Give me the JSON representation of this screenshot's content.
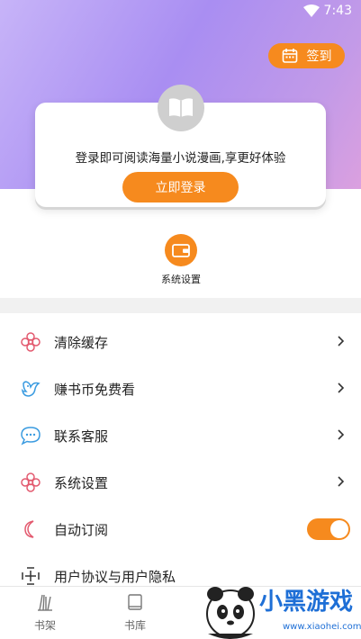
{
  "status_bar": {
    "time": "7:43",
    "wifi_icon": "wifi-icon"
  },
  "header": {
    "signin_label": "签到",
    "signin_icon": "calendar-icon"
  },
  "login_card": {
    "book_icon": "book-icon",
    "prompt": "登录即可阅读海量小说漫画,享更好体验",
    "login_label": "立即登录"
  },
  "quick_actions": [
    {
      "label": "系统设置",
      "icon": "wallet-icon"
    }
  ],
  "menu": {
    "items": [
      {
        "label": "清除缓存",
        "icon": "flower-icon"
      },
      {
        "label": "赚书币免费看",
        "icon": "bird-icon"
      },
      {
        "label": "联系客服",
        "icon": "chat-icon"
      },
      {
        "label": "系统设置",
        "icon": "flower-icon"
      },
      {
        "label": "自动订阅",
        "icon": "moon-icon",
        "toggle": true
      },
      {
        "label": "用户协议与用户隐私",
        "icon": "crosshair-icon"
      }
    ]
  },
  "tabbar": {
    "tabs": [
      {
        "label": "书架",
        "icon": "bookshelf-icon"
      },
      {
        "label": "书库",
        "icon": "library-icon"
      }
    ]
  },
  "watermark": {
    "brand": "小黑游戏",
    "url": "www.xiaohei.com"
  },
  "colors": {
    "accent": "#f68a1e",
    "hero_start": "#c7b4f8",
    "hero_end": "#dba0df"
  }
}
